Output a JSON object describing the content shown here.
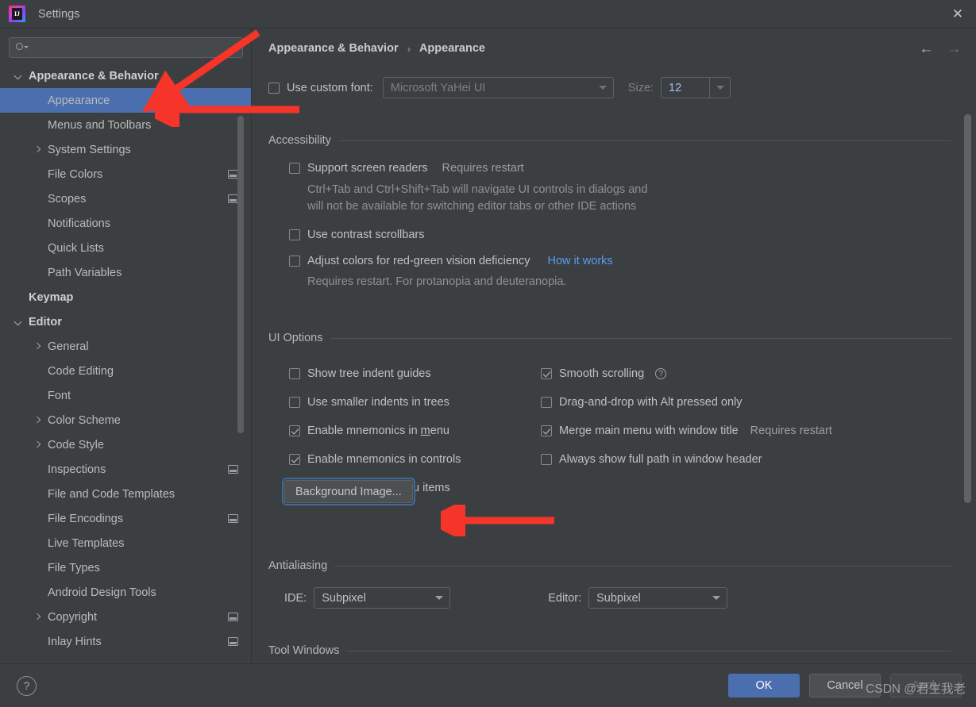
{
  "window": {
    "title": "Settings",
    "logo_text": "IJ",
    "logo_icon": "intellij-idea-logo",
    "close_icon": "close-icon"
  },
  "sidebar": {
    "search": {
      "placeholder": "",
      "value": "",
      "icon": "search-icon"
    },
    "items": [
      {
        "label": "Appearance & Behavior",
        "indent": 0,
        "twisty": "down",
        "bold": true,
        "selected": false,
        "icon": null
      },
      {
        "label": "Appearance",
        "indent": 1,
        "twisty": null,
        "bold": false,
        "selected": true,
        "icon": null
      },
      {
        "label": "Menus and Toolbars",
        "indent": 1,
        "twisty": null,
        "bold": false,
        "selected": false,
        "icon": null
      },
      {
        "label": "System Settings",
        "indent": 1,
        "twisty": "right",
        "bold": false,
        "selected": false,
        "icon": null
      },
      {
        "label": "File Colors",
        "indent": 1,
        "twisty": null,
        "bold": false,
        "selected": false,
        "icon": "project-scope-icon"
      },
      {
        "label": "Scopes",
        "indent": 1,
        "twisty": null,
        "bold": false,
        "selected": false,
        "icon": "project-scope-icon"
      },
      {
        "label": "Notifications",
        "indent": 1,
        "twisty": null,
        "bold": false,
        "selected": false,
        "icon": null
      },
      {
        "label": "Quick Lists",
        "indent": 1,
        "twisty": null,
        "bold": false,
        "selected": false,
        "icon": null
      },
      {
        "label": "Path Variables",
        "indent": 1,
        "twisty": null,
        "bold": false,
        "selected": false,
        "icon": null
      },
      {
        "label": "Keymap",
        "indent": 0,
        "twisty": null,
        "bold": true,
        "selected": false,
        "icon": null
      },
      {
        "label": "Editor",
        "indent": 0,
        "twisty": "down",
        "bold": true,
        "selected": false,
        "icon": null
      },
      {
        "label": "General",
        "indent": 1,
        "twisty": "right",
        "bold": false,
        "selected": false,
        "icon": null
      },
      {
        "label": "Code Editing",
        "indent": 1,
        "twisty": null,
        "bold": false,
        "selected": false,
        "icon": null
      },
      {
        "label": "Font",
        "indent": 1,
        "twisty": null,
        "bold": false,
        "selected": false,
        "icon": null
      },
      {
        "label": "Color Scheme",
        "indent": 1,
        "twisty": "right",
        "bold": false,
        "selected": false,
        "icon": null
      },
      {
        "label": "Code Style",
        "indent": 1,
        "twisty": "right",
        "bold": false,
        "selected": false,
        "icon": null
      },
      {
        "label": "Inspections",
        "indent": 1,
        "twisty": null,
        "bold": false,
        "selected": false,
        "icon": "project-scope-icon"
      },
      {
        "label": "File and Code Templates",
        "indent": 1,
        "twisty": null,
        "bold": false,
        "selected": false,
        "icon": null
      },
      {
        "label": "File Encodings",
        "indent": 1,
        "twisty": null,
        "bold": false,
        "selected": false,
        "icon": "project-scope-icon"
      },
      {
        "label": "Live Templates",
        "indent": 1,
        "twisty": null,
        "bold": false,
        "selected": false,
        "icon": null
      },
      {
        "label": "File Types",
        "indent": 1,
        "twisty": null,
        "bold": false,
        "selected": false,
        "icon": null
      },
      {
        "label": "Android Design Tools",
        "indent": 1,
        "twisty": null,
        "bold": false,
        "selected": false,
        "icon": null
      },
      {
        "label": "Copyright",
        "indent": 1,
        "twisty": "right",
        "bold": false,
        "selected": false,
        "icon": "project-scope-icon"
      },
      {
        "label": "Inlay Hints",
        "indent": 1,
        "twisty": null,
        "bold": false,
        "selected": false,
        "icon": "project-scope-icon"
      }
    ]
  },
  "content": {
    "breadcrumb": {
      "parent": "Appearance & Behavior",
      "separator": "›",
      "current": "Appearance"
    },
    "nav": {
      "back_icon": "arrow-left-icon",
      "forward_icon": "arrow-right-icon"
    },
    "custom_font": {
      "checkbox_label": "Use custom font:",
      "checked": false,
      "font_value": "Microsoft YaHei UI",
      "size_label": "Size:",
      "size_value": "12"
    },
    "accessibility": {
      "title": "Accessibility",
      "screen_readers": {
        "label": "Support screen readers",
        "checked": false,
        "note": "Requires restart"
      },
      "screen_readers_desc_line1": "Ctrl+Tab and Ctrl+Shift+Tab will navigate UI controls in dialogs and",
      "screen_readers_desc_line2": "will not be available for switching editor tabs or other IDE actions",
      "contrast_scrollbars": {
        "label": "Use contrast scrollbars",
        "checked": false
      },
      "red_green": {
        "label": "Adjust colors for red-green vision deficiency",
        "checked": false,
        "link": "How it works"
      },
      "red_green_desc": "Requires restart. For protanopia and deuteranopia."
    },
    "ui_options": {
      "title": "UI Options",
      "left": [
        {
          "label": "Show tree indent guides",
          "checked": false
        },
        {
          "label": "Use smaller indents in trees",
          "checked": false
        },
        {
          "label": "Enable mnemonics in menu",
          "checked": true,
          "mnemonic": "m"
        },
        {
          "label": "Enable mnemonics in controls",
          "checked": true
        },
        {
          "label": "Display icons in menu items",
          "checked": true
        }
      ],
      "right": [
        {
          "label": "Smooth scrolling",
          "checked": true,
          "help": "?"
        },
        {
          "label": "Drag-and-drop with Alt pressed only",
          "checked": false
        },
        {
          "label": "Merge main menu with window title",
          "checked": true,
          "note": "Requires restart"
        },
        {
          "label": "Always show full path in window header",
          "checked": false
        }
      ],
      "background_image_button": "Background Image..."
    },
    "antialiasing": {
      "title": "Antialiasing",
      "ide_label": "IDE:",
      "ide_value": "Subpixel",
      "editor_label": "Editor:",
      "editor_value": "Subpixel"
    },
    "tool_windows": {
      "title": "Tool Windows"
    }
  },
  "footer": {
    "help_icon": "?",
    "ok": "OK",
    "cancel": "Cancel",
    "apply": "Apply",
    "watermark": "CSDN @君生我老"
  },
  "colors": {
    "background": "#3c3f41",
    "selection": "#4b6eaf",
    "link": "#589df6",
    "annotation": "#f5342a"
  }
}
